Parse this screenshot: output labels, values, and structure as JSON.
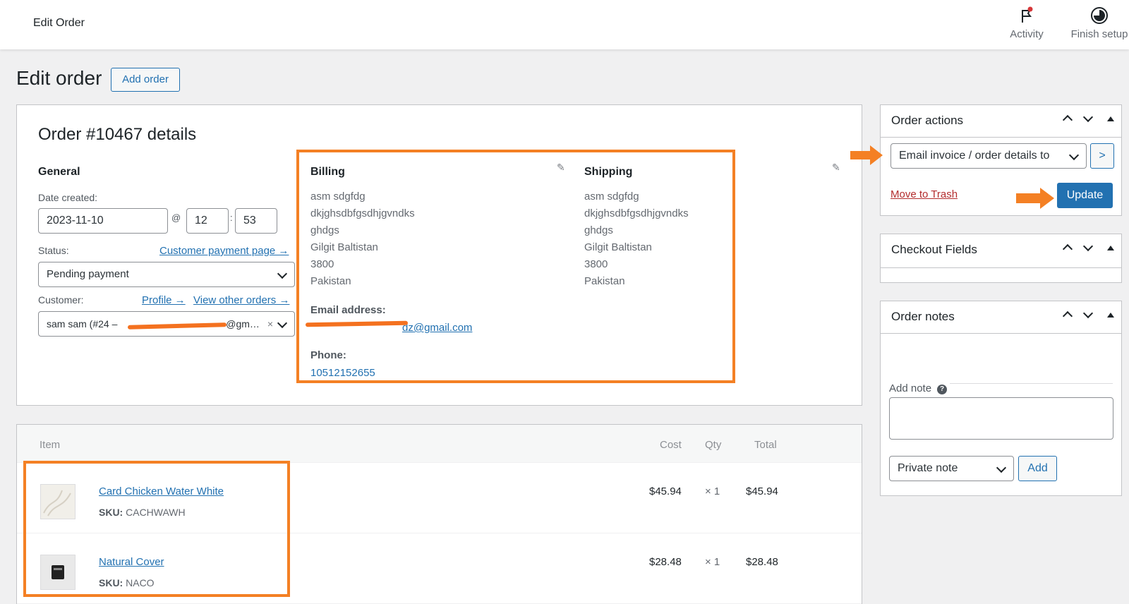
{
  "topbar": {
    "title": "Edit Order",
    "activity_label": "Activity",
    "finish_setup_label": "Finish setup"
  },
  "page": {
    "title": "Edit order",
    "add_order_label": "Add order"
  },
  "order": {
    "heading": "Order #10467 details",
    "general_label": "General",
    "date_created_label": "Date created:",
    "date": "2023-11-10",
    "at_sep": "@",
    "hour": "12",
    "colon_sep": ":",
    "minute": "53",
    "status_label": "Status:",
    "customer_payment_link": "Customer payment page →",
    "status_value": "Pending payment",
    "customer_label": "Customer:",
    "profile_link": "Profile →",
    "view_other_orders_link": "View other orders →",
    "customer_value": "sam sam (#24 – ",
    "customer_value_end": "@gm…",
    "clear_x": "×"
  },
  "billing": {
    "title": "Billing",
    "lines": [
      "asm sdgfdg",
      "dkjghsdbfgsdhjgvndks",
      "ghdgs",
      "Gilgit Baltistan",
      "3800",
      "Pakistan"
    ],
    "email_label": "Email address:",
    "email_value": "dz@gmail.com",
    "phone_label": "Phone:",
    "phone_value": "10512152655"
  },
  "shipping": {
    "title": "Shipping",
    "lines": [
      "asm sdgfdg",
      "dkjghsdbfgsdhjgvndks",
      "ghdgs",
      "Gilgit Baltistan",
      "3800",
      "Pakistan"
    ]
  },
  "items": {
    "headers": {
      "item": "Item",
      "cost": "Cost",
      "qty": "Qty",
      "total": "Total"
    },
    "rows": [
      {
        "name": "Card Chicken Water White",
        "sku_label": "SKU:",
        "sku": "CACHWAWH",
        "cost": "$45.94",
        "qty": "× 1",
        "total": "$45.94"
      },
      {
        "name": "Natural Cover",
        "sku_label": "SKU:",
        "sku": "NACO",
        "cost": "$28.48",
        "qty": "× 1",
        "total": "$28.48"
      }
    ]
  },
  "sidebar": {
    "order_actions": {
      "title": "Order actions",
      "select_value": "Email invoice / order details to",
      "go_label": ">",
      "trash_label": "Move to Trash",
      "update_label": "Update"
    },
    "checkout_fields": {
      "title": "Checkout Fields"
    },
    "order_notes": {
      "title": "Order notes",
      "add_note_label": "Add note",
      "help_glyph": "?",
      "note_type_value": "Private note",
      "add_label": "Add"
    }
  },
  "colors": {
    "accent": "#2271b1",
    "highlight": "#f48024",
    "danger": "#b32d2e"
  }
}
